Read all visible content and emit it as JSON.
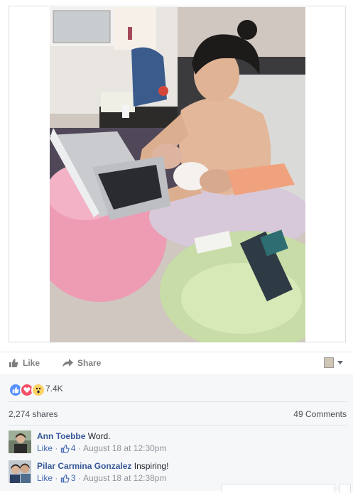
{
  "post": {
    "photo_alt": "",
    "actions": {
      "like_label": "Like",
      "share_label": "Share"
    }
  },
  "reactions": {
    "types": [
      "like-icon",
      "love-icon",
      "wow-icon"
    ],
    "count": "7.4K"
  },
  "stats": {
    "shares": "2,274 shares",
    "comments": "49 Comments"
  },
  "comments": [
    {
      "name": "Ann Toebbe",
      "text": "Word.",
      "like_label": "Like",
      "likes": "4",
      "time": "August 18 at 12:30pm"
    },
    {
      "name": "Pilar Carmina Gonzalez",
      "text": "Inspiring!",
      "like_label": "Like",
      "likes": "3",
      "time": "August 18 at 12:38pm"
    }
  ],
  "colors": {
    "link": "#365899",
    "meta": "#90949c",
    "like_blue": "#5890ff",
    "love_red": "#f25268",
    "wow_yellow": "#fcd264"
  }
}
